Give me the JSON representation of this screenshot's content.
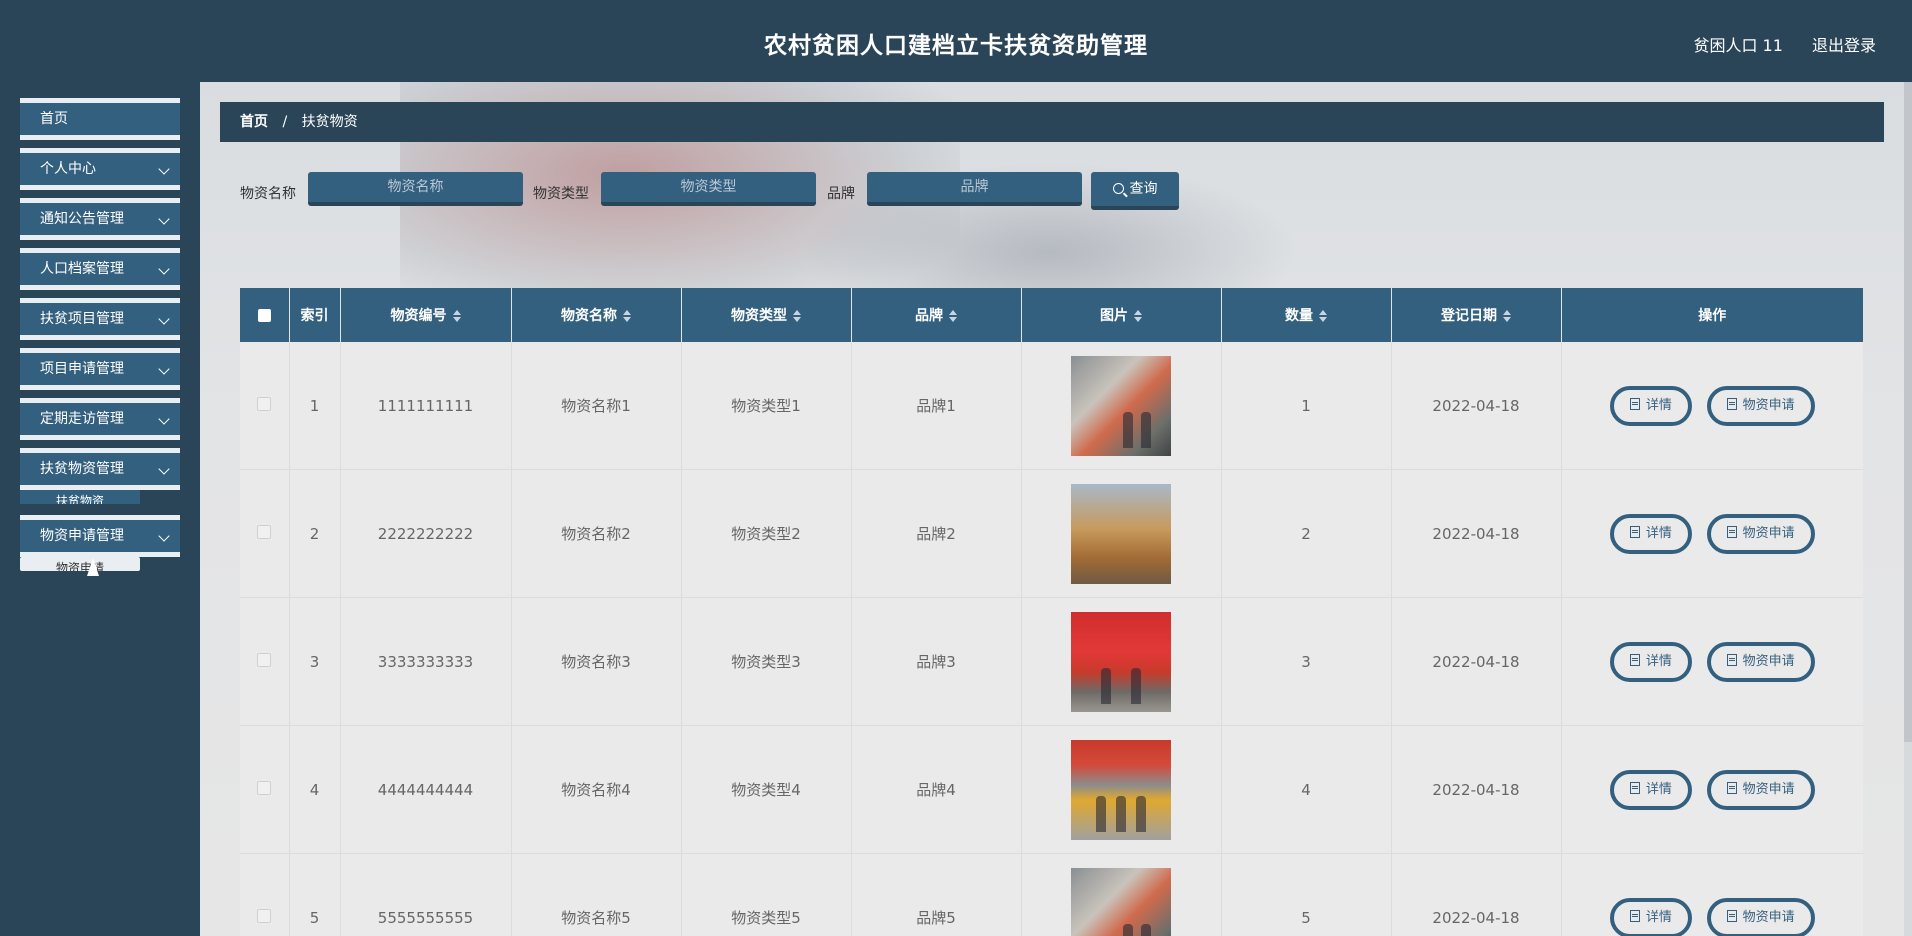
{
  "header": {
    "title": "农村贫困人口建档立卡扶贫资助管理",
    "user": "贫困人口 11",
    "logout": "退出登录"
  },
  "sidebar": {
    "items": [
      {
        "label": "首页"
      },
      {
        "label": "个人中心"
      },
      {
        "label": "通知公告管理"
      },
      {
        "label": "人口档案管理"
      },
      {
        "label": "扶贫项目管理"
      },
      {
        "label": "项目申请管理"
      },
      {
        "label": "定期走访管理"
      },
      {
        "label": "扶贫物资管理"
      },
      {
        "label": "物资申请管理"
      }
    ],
    "submenus": [
      {
        "label": "扶贫物资"
      },
      {
        "label": "物资申请"
      }
    ]
  },
  "breadcrumb": {
    "home": "首页",
    "separator": "/",
    "current": "扶贫物资"
  },
  "search": {
    "name_label": "物资名称",
    "name_placeholder": "物资名称",
    "type_label": "物资类型",
    "type_placeholder": "物资类型",
    "brand_label": "品牌",
    "brand_placeholder": "品牌",
    "query_button": "查询"
  },
  "table": {
    "columns": [
      "索引",
      "物资编号",
      "物资名称",
      "物资类型",
      "品牌",
      "图片",
      "数量",
      "登记日期",
      "操作"
    ],
    "rows": [
      {
        "index": "1",
        "code": "1111111111",
        "name": "物资名称1",
        "type": "物资类型1",
        "brand": "品牌1",
        "qty": "1",
        "date": "2022-04-18"
      },
      {
        "index": "2",
        "code": "2222222222",
        "name": "物资名称2",
        "type": "物资类型2",
        "brand": "品牌2",
        "qty": "2",
        "date": "2022-04-18"
      },
      {
        "index": "3",
        "code": "3333333333",
        "name": "物资名称3",
        "type": "物资类型3",
        "brand": "品牌3",
        "qty": "3",
        "date": "2022-04-18"
      },
      {
        "index": "4",
        "code": "4444444444",
        "name": "物资名称4",
        "type": "物资类型4",
        "brand": "品牌4",
        "qty": "4",
        "date": "2022-04-18"
      },
      {
        "index": "5",
        "code": "5555555555",
        "name": "物资名称5",
        "type": "物资类型5",
        "brand": "品牌5",
        "qty": "5",
        "date": "2022-04-18"
      }
    ],
    "actions": {
      "detail": "详情",
      "apply": "物资申请"
    }
  },
  "colors": {
    "primary": "#34607f",
    "dark": "#2b4558"
  }
}
